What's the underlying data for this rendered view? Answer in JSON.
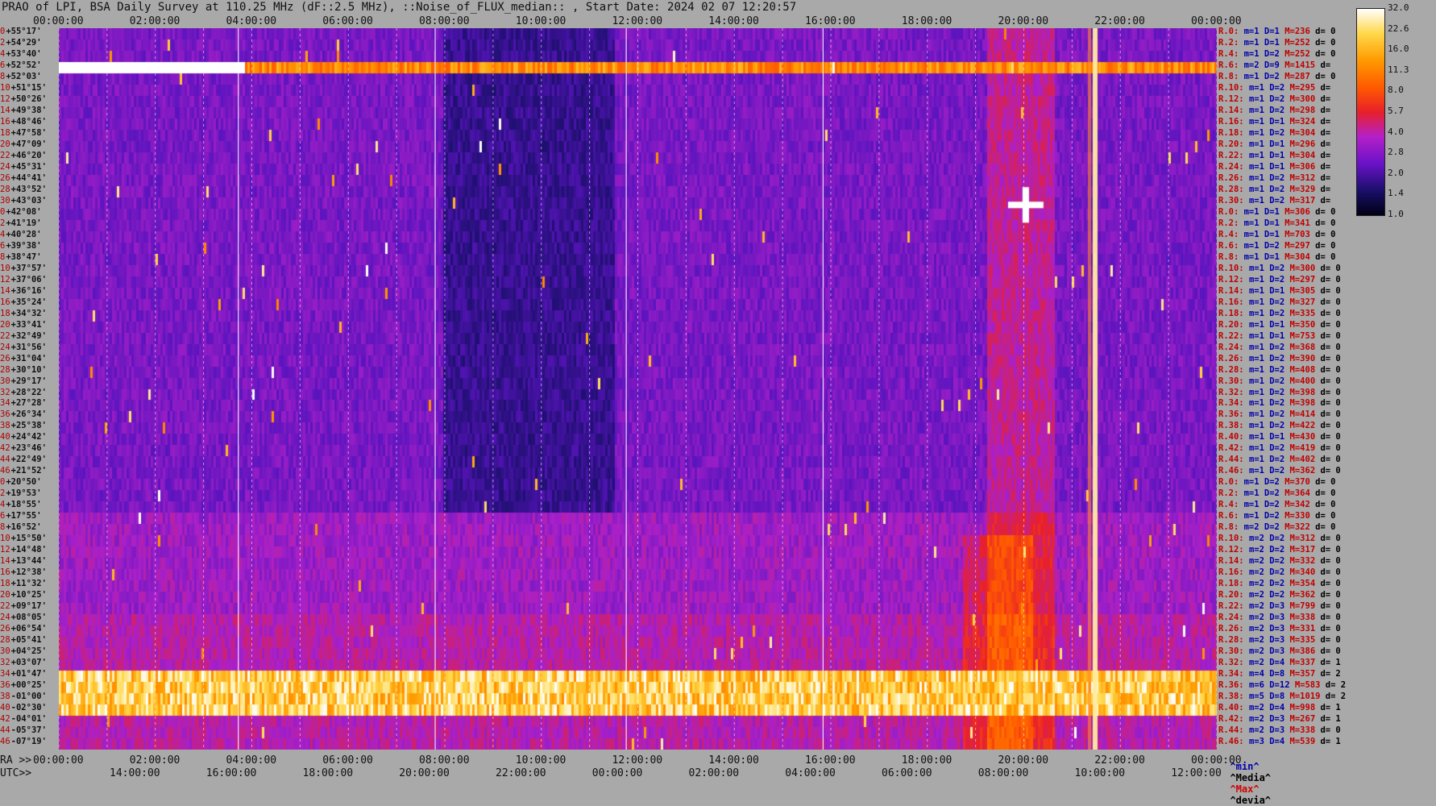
{
  "title": "PRAO of LPI, BSA Daily Survey at 110.25 MHz (dF::2.5 MHz), ::Noise_of_FLUX_median:: , Start Date: 2024 02 07 12:20:57",
  "top_axis_ticks": [
    "00:00:00",
    "02:00:00",
    "04:00:00",
    "06:00:00",
    "08:00:00",
    "10:00:00",
    "12:00:00",
    "14:00:00",
    "16:00:00",
    "18:00:00",
    "20:00:00",
    "22:00:00",
    "00:00:00"
  ],
  "bottom_ra_prefix": "RA >>",
  "bottom_ra_ticks": [
    "00:00:00",
    "02:00:00",
    "04:00:00",
    "06:00:00",
    "08:00:00",
    "10:00:00",
    "12:00:00",
    "14:00:00",
    "16:00:00",
    "18:00:00",
    "20:00:00",
    "22:00:00",
    "00:00:00"
  ],
  "bottom_utc_prefix": "UTC>>",
  "bottom_utc_ticks": [
    "14:00:00",
    "16:00:00",
    "18:00:00",
    "20:00:00",
    "22:00:00",
    "00:00:00",
    "02:00:00",
    "04:00:00",
    "06:00:00",
    "08:00:00",
    "10:00:00",
    "12:00:00"
  ],
  "declination_labels": [
    {
      "idx": "0",
      "dec": "+55°17'"
    },
    {
      "idx": "2",
      "dec": "+54°29'"
    },
    {
      "idx": "4",
      "dec": "+53°40'"
    },
    {
      "idx": "6",
      "dec": "+52°52'"
    },
    {
      "idx": "8",
      "dec": "+52°03'"
    },
    {
      "idx": "10",
      "dec": "+51°15'"
    },
    {
      "idx": "12",
      "dec": "+50°26'"
    },
    {
      "idx": "14",
      "dec": "+49°38'"
    },
    {
      "idx": "16",
      "dec": "+48°46'"
    },
    {
      "idx": "18",
      "dec": "+47°58'"
    },
    {
      "idx": "20",
      "dec": "+47°09'"
    },
    {
      "idx": "22",
      "dec": "+46°20'"
    },
    {
      "idx": "24",
      "dec": "+45°31'"
    },
    {
      "idx": "26",
      "dec": "+44°41'"
    },
    {
      "idx": "28",
      "dec": "+43°52'"
    },
    {
      "idx": "30",
      "dec": "+43°03'"
    },
    {
      "idx": "0",
      "dec": "+42°08'"
    },
    {
      "idx": "2",
      "dec": "+41°19'"
    },
    {
      "idx": "4",
      "dec": "+40°28'"
    },
    {
      "idx": "6",
      "dec": "+39°38'"
    },
    {
      "idx": "8",
      "dec": "+38°47'"
    },
    {
      "idx": "10",
      "dec": "+37°57'"
    },
    {
      "idx": "12",
      "dec": "+37°06'"
    },
    {
      "idx": "14",
      "dec": "+36°16'"
    },
    {
      "idx": "16",
      "dec": "+35°24'"
    },
    {
      "idx": "18",
      "dec": "+34°32'"
    },
    {
      "idx": "20",
      "dec": "+33°41'"
    },
    {
      "idx": "22",
      "dec": "+32°49'"
    },
    {
      "idx": "24",
      "dec": "+31°56'"
    },
    {
      "idx": "26",
      "dec": "+31°04'"
    },
    {
      "idx": "28",
      "dec": "+30°10'"
    },
    {
      "idx": "30",
      "dec": "+29°17'"
    },
    {
      "idx": "32",
      "dec": "+28°22'"
    },
    {
      "idx": "34",
      "dec": "+27°28'"
    },
    {
      "idx": "36",
      "dec": "+26°34'"
    },
    {
      "idx": "38",
      "dec": "+25°38'"
    },
    {
      "idx": "40",
      "dec": "+24°42'"
    },
    {
      "idx": "42",
      "dec": "+23°46'"
    },
    {
      "idx": "44",
      "dec": "+22°49'"
    },
    {
      "idx": "46",
      "dec": "+21°52'"
    },
    {
      "idx": "0",
      "dec": "+20°50'"
    },
    {
      "idx": "2",
      "dec": "+19°53'"
    },
    {
      "idx": "4",
      "dec": "+18°55'"
    },
    {
      "idx": "6",
      "dec": "+17°55'"
    },
    {
      "idx": "8",
      "dec": "+16°52'"
    },
    {
      "idx": "10",
      "dec": "+15°50'"
    },
    {
      "idx": "12",
      "dec": "+14°48'"
    },
    {
      "idx": "14",
      "dec": "+13°44'"
    },
    {
      "idx": "16",
      "dec": "+12°38'"
    },
    {
      "idx": "18",
      "dec": "+11°32'"
    },
    {
      "idx": "20",
      "dec": "+10°25'"
    },
    {
      "idx": "22",
      "dec": "+09°17'"
    },
    {
      "idx": "24",
      "dec": "+08°05'"
    },
    {
      "idx": "26",
      "dec": "+06°54'"
    },
    {
      "idx": "28",
      "dec": "+05°41'"
    },
    {
      "idx": "30",
      "dec": "+04°25'"
    },
    {
      "idx": "32",
      "dec": "+03°07'"
    },
    {
      "idx": "34",
      "dec": "+01°47'"
    },
    {
      "idx": "36",
      "dec": "+00°25'"
    },
    {
      "idx": "38",
      "dec": "-01°00'"
    },
    {
      "idx": "40",
      "dec": "-02°30'"
    },
    {
      "idx": "42",
      "dec": "-04°01'"
    },
    {
      "idx": "44",
      "dec": "-05°37'"
    },
    {
      "idx": "46",
      "dec": "-07°19'"
    }
  ],
  "row_stats": [
    {
      "r": "R.0:",
      "m": "m=1",
      "d": "D=1",
      "mx": "M=236",
      "dv": "d= 0"
    },
    {
      "r": "R.2:",
      "m": "m=1",
      "d": "D=1",
      "mx": "M=252",
      "dv": "d= 0"
    },
    {
      "r": "R.4:",
      "m": "m=1",
      "d": "D=2",
      "mx": "M=252",
      "dv": "d= 0"
    },
    {
      "r": "R.6:",
      "m": "m=2",
      "d": "D=9",
      "mx": "M=1415",
      "dv": "d="
    },
    {
      "r": "R.8:",
      "m": "m=1",
      "d": "D=2",
      "mx": "M=287",
      "dv": "d= 0"
    },
    {
      "r": "R.10:",
      "m": "m=1",
      "d": "D=2",
      "mx": "M=295",
      "dv": "d="
    },
    {
      "r": "R.12:",
      "m": "m=1",
      "d": "D=2",
      "mx": "M=300",
      "dv": "d="
    },
    {
      "r": "R.14:",
      "m": "m=1",
      "d": "D=2",
      "mx": "M=298",
      "dv": "d="
    },
    {
      "r": "R.16:",
      "m": "m=1",
      "d": "D=1",
      "mx": "M=324",
      "dv": "d="
    },
    {
      "r": "R.18:",
      "m": "m=1",
      "d": "D=2",
      "mx": "M=304",
      "dv": "d="
    },
    {
      "r": "R.20:",
      "m": "m=1",
      "d": "D=1",
      "mx": "M=296",
      "dv": "d="
    },
    {
      "r": "R.22:",
      "m": "m=1",
      "d": "D=1",
      "mx": "M=304",
      "dv": "d="
    },
    {
      "r": "R.24:",
      "m": "m=1",
      "d": "D=1",
      "mx": "M=306",
      "dv": "d="
    },
    {
      "r": "R.26:",
      "m": "m=1",
      "d": "D=2",
      "mx": "M=312",
      "dv": "d="
    },
    {
      "r": "R.28:",
      "m": "m=1",
      "d": "D=2",
      "mx": "M=329",
      "dv": "d="
    },
    {
      "r": "R.30:",
      "m": "m=1",
      "d": "D=2",
      "mx": "M=317",
      "dv": "d="
    },
    {
      "r": "R.0:",
      "m": "m=1",
      "d": "D=1",
      "mx": "M=306",
      "dv": "d= 0"
    },
    {
      "r": "R.2:",
      "m": "m=1",
      "d": "D=1",
      "mx": "M=341",
      "dv": "d= 0"
    },
    {
      "r": "R.4:",
      "m": "m=1",
      "d": "D=1",
      "mx": "M=703",
      "dv": "d= 0"
    },
    {
      "r": "R.6:",
      "m": "m=1",
      "d": "D=2",
      "mx": "M=297",
      "dv": "d= 0"
    },
    {
      "r": "R.8:",
      "m": "m=1",
      "d": "D=1",
      "mx": "M=304",
      "dv": "d= 0"
    },
    {
      "r": "R.10:",
      "m": "m=1",
      "d": "D=2",
      "mx": "M=300",
      "dv": "d= 0"
    },
    {
      "r": "R.12:",
      "m": "m=1",
      "d": "D=2",
      "mx": "M=297",
      "dv": "d= 0"
    },
    {
      "r": "R.14:",
      "m": "m=1",
      "d": "D=1",
      "mx": "M=305",
      "dv": "d= 0"
    },
    {
      "r": "R.16:",
      "m": "m=1",
      "d": "D=2",
      "mx": "M=327",
      "dv": "d= 0"
    },
    {
      "r": "R.18:",
      "m": "m=1",
      "d": "D=2",
      "mx": "M=335",
      "dv": "d= 0"
    },
    {
      "r": "R.20:",
      "m": "m=1",
      "d": "D=1",
      "mx": "M=350",
      "dv": "d= 0"
    },
    {
      "r": "R.22:",
      "m": "m=1",
      "d": "D=1",
      "mx": "M=753",
      "dv": "d= 0"
    },
    {
      "r": "R.24:",
      "m": "m=1",
      "d": "D=2",
      "mx": "M=368",
      "dv": "d= 0"
    },
    {
      "r": "R.26:",
      "m": "m=1",
      "d": "D=2",
      "mx": "M=390",
      "dv": "d= 0"
    },
    {
      "r": "R.28:",
      "m": "m=1",
      "d": "D=2",
      "mx": "M=408",
      "dv": "d= 0"
    },
    {
      "r": "R.30:",
      "m": "m=1",
      "d": "D=2",
      "mx": "M=400",
      "dv": "d= 0"
    },
    {
      "r": "R.32:",
      "m": "m=1",
      "d": "D=2",
      "mx": "M=398",
      "dv": "d= 0"
    },
    {
      "r": "R.34:",
      "m": "m=1",
      "d": "D=2",
      "mx": "M=398",
      "dv": "d= 0"
    },
    {
      "r": "R.36:",
      "m": "m=1",
      "d": "D=2",
      "mx": "M=414",
      "dv": "d= 0"
    },
    {
      "r": "R.38:",
      "m": "m=1",
      "d": "D=2",
      "mx": "M=422",
      "dv": "d= 0"
    },
    {
      "r": "R.40:",
      "m": "m=1",
      "d": "D=1",
      "mx": "M=430",
      "dv": "d= 0"
    },
    {
      "r": "R.42:",
      "m": "m=1",
      "d": "D=2",
      "mx": "M=419",
      "dv": "d= 0"
    },
    {
      "r": "R.44:",
      "m": "m=1",
      "d": "D=2",
      "mx": "M=402",
      "dv": "d= 0"
    },
    {
      "r": "R.46:",
      "m": "m=1",
      "d": "D=2",
      "mx": "M=362",
      "dv": "d= 0"
    },
    {
      "r": "R.0:",
      "m": "m=1",
      "d": "D=2",
      "mx": "M=370",
      "dv": "d= 0"
    },
    {
      "r": "R.2:",
      "m": "m=1",
      "d": "D=2",
      "mx": "M=364",
      "dv": "d= 0"
    },
    {
      "r": "R.4:",
      "m": "m=1",
      "d": "D=2",
      "mx": "M=342",
      "dv": "d= 0"
    },
    {
      "r": "R.6:",
      "m": "m=1",
      "d": "D=2",
      "mx": "M=330",
      "dv": "d= 0"
    },
    {
      "r": "R.8:",
      "m": "m=2",
      "d": "D=2",
      "mx": "M=322",
      "dv": "d= 0"
    },
    {
      "r": "R.10:",
      "m": "m=2",
      "d": "D=2",
      "mx": "M=312",
      "dv": "d= 0"
    },
    {
      "r": "R.12:",
      "m": "m=2",
      "d": "D=2",
      "mx": "M=317",
      "dv": "d= 0"
    },
    {
      "r": "R.14:",
      "m": "m=2",
      "d": "D=2",
      "mx": "M=332",
      "dv": "d= 0"
    },
    {
      "r": "R.16:",
      "m": "m=2",
      "d": "D=2",
      "mx": "M=340",
      "dv": "d= 0"
    },
    {
      "r": "R.18:",
      "m": "m=2",
      "d": "D=2",
      "mx": "M=354",
      "dv": "d= 0"
    },
    {
      "r": "R.20:",
      "m": "m=2",
      "d": "D=2",
      "mx": "M=362",
      "dv": "d= 0"
    },
    {
      "r": "R.22:",
      "m": "m=2",
      "d": "D=3",
      "mx": "M=799",
      "dv": "d= 0"
    },
    {
      "r": "R.24:",
      "m": "m=2",
      "d": "D=3",
      "mx": "M=338",
      "dv": "d= 0"
    },
    {
      "r": "R.26:",
      "m": "m=2",
      "d": "D=3",
      "mx": "M=331",
      "dv": "d= 0"
    },
    {
      "r": "R.28:",
      "m": "m=2",
      "d": "D=3",
      "mx": "M=335",
      "dv": "d= 0"
    },
    {
      "r": "R.30:",
      "m": "m=2",
      "d": "D=3",
      "mx": "M=386",
      "dv": "d= 0"
    },
    {
      "r": "R.32:",
      "m": "m=2",
      "d": "D=4",
      "mx": "M=337",
      "dv": "d= 1"
    },
    {
      "r": "R.34:",
      "m": "m=4",
      "d": "D=8",
      "mx": "M=357",
      "dv": "d= 2"
    },
    {
      "r": "R.36:",
      "m": "m=6",
      "d": "D=12",
      "mx": "M=583",
      "dv": "d= 2"
    },
    {
      "r": "R.38:",
      "m": "m=5",
      "d": "D=8",
      "mx": "M=1019",
      "dv": "d= 2"
    },
    {
      "r": "R.40:",
      "m": "m=2",
      "d": "D=4",
      "mx": "M=998",
      "dv": "d= 1"
    },
    {
      "r": "R.42:",
      "m": "m=2",
      "d": "D=3",
      "mx": "M=267",
      "dv": "d= 1"
    },
    {
      "r": "R.44:",
      "m": "m=2",
      "d": "D=3",
      "mx": "M=338",
      "dv": "d= 0"
    },
    {
      "r": "R.46:",
      "m": "m=3",
      "d": "D=4",
      "mx": "M=539",
      "dv": "d= 1"
    }
  ],
  "stat_footer": {
    "min": "^min^",
    "median": "^Media^",
    "max": "^Max^",
    "devia": "^devia^"
  },
  "colorbar_ticks": [
    "32.0",
    "22.6",
    "16.0",
    "11.3",
    "8.0",
    "5.7",
    "4.0",
    "2.8",
    "2.0",
    "1.4",
    "1.0"
  ],
  "chart_data": {
    "type": "heatmap",
    "title": "PRAO of LPI, BSA Daily Survey at 110.25 MHz (dF::2.5 MHz), ::Noise_of_FLUX_median:: , Start Date: 2024 02 07 12:20:57",
    "x_axis_top": [
      "00:00:00",
      "02:00:00",
      "04:00:00",
      "06:00:00",
      "08:00:00",
      "10:00:00",
      "12:00:00",
      "14:00:00",
      "16:00:00",
      "18:00:00",
      "20:00:00",
      "22:00:00",
      "00:00:00"
    ],
    "x_axis_ra_range": [
      "00:00:00",
      "24:00:00"
    ],
    "x_axis_utc_ticks": [
      "14:00:00",
      "16:00:00",
      "18:00:00",
      "20:00:00",
      "22:00:00",
      "00:00:00",
      "02:00:00",
      "04:00:00",
      "06:00:00",
      "08:00:00",
      "10:00:00",
      "12:00:00"
    ],
    "y_axis_range_dec": [
      "+55°17'",
      "-07°19'"
    ],
    "n_beam_rows": 64,
    "colorbar": {
      "min": 1.0,
      "max": 32.0,
      "scale": "log2",
      "ticks": [
        32.0,
        22.6,
        16.0,
        11.3,
        8.0,
        5.7,
        4.0,
        2.8,
        2.0,
        1.4,
        1.0
      ]
    },
    "features": [
      {
        "kind": "bright_horizontal_band",
        "dec": "+52°52'",
        "level": "high"
      },
      {
        "kind": "bright_horizontal_band",
        "dec_range": [
          "+01°47'",
          "-02°30'"
        ],
        "level": "very high"
      },
      {
        "kind": "bright_vertical_stripe",
        "ra": "21:30",
        "level": "very high"
      },
      {
        "kind": "bright_source",
        "ra": "20:00",
        "dec": "+41°19'",
        "level": "very high"
      }
    ],
    "grid": true
  }
}
